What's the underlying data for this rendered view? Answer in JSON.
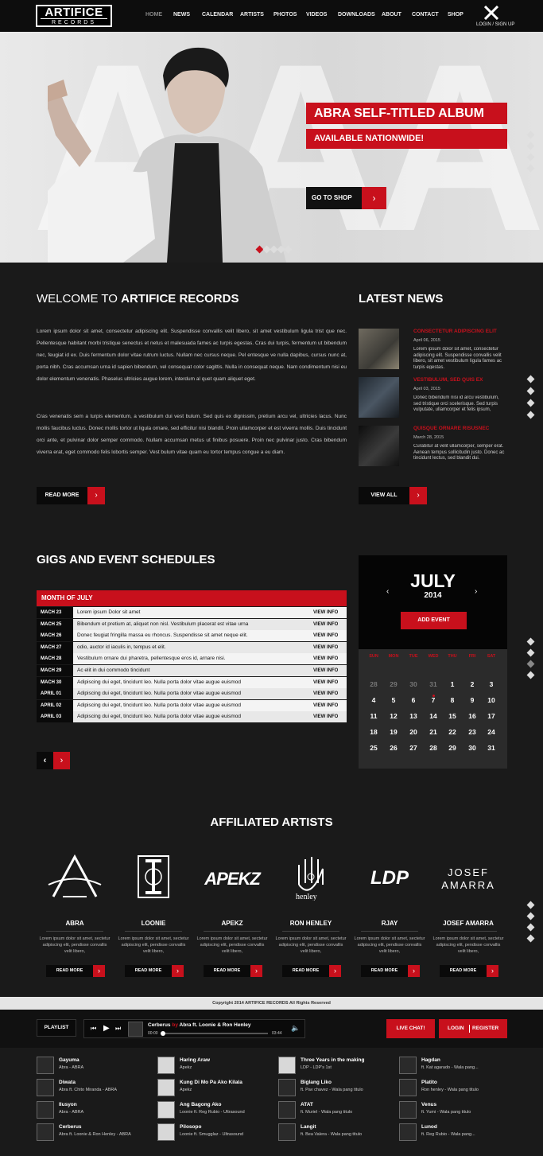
{
  "nav": {
    "logo_top": "ARTIFICE",
    "logo_bottom": "RECORDS",
    "items": [
      "HOME",
      "NEWS",
      "CALENDAR",
      "ARTISTS",
      "PHOTOS",
      "VIDEOS",
      "DOWNLOADS",
      "ABOUT",
      "CONTACT",
      "SHOP"
    ],
    "login_label": "LOGIN / SIGN UP"
  },
  "hero": {
    "headline": "ABRA SELF-TITLED ALBUM",
    "subline": "AVAILABLE NATIONWIDE!",
    "cta_label": "GO TO SHOP"
  },
  "welcome": {
    "title_light": "WELCOME TO ",
    "title_bold": "ARTIFICE RECORDS",
    "p1": "Lorem ipsum dolor sit amet, consectetur adipiscing elit. Suspendisse convallis velit libero, sit amet vestibulum ligula trist que nec. Pellentesque habitant morbi tristique senectus et netus et malesuada fames ac turpis egestas. Cras dui turpis, fermentum ut bibendum nec, feugiat id ex. Duis fermentum dolor vitae rutrum luctus. Nullam nec cursus neque. Pel entesque ve nulla dapibus, cursus nunc at, porta nibh. Cras accumsan urna id sapien bibendum, vel consequat color sagittis. Nulla in consequat neque. Nam condimentum nisi eu dolor elementum venenatis. Phaselus ultricies augue lorem, interdum al quet quam aliquet eget.",
    "p2": "Cras venenatis sem a turpis elementum, a vestibulum dui vest bulum. Sed quis ex dignissim, pretium arcu vel, ultricies lacus. Nunc mollis faucibus luctus. Donec mollis tortor ut ligula ornare, sed efficitur nisi blandit. Proin ullamcorper et est viverra mollis. Duis tincidunt orci ante, et pulvinar dolor semper commodo. Nullam accumsan metus ut finibus posuere. Proin nec pulvinar justo. Cras bibendum viverra erat, eget commodo felis lobortis semper. Vest bulum vitae quam eu tortor tempus congue a eu diam.",
    "read_more": "READ MORE"
  },
  "news": {
    "title": "LATEST NEWS",
    "items": [
      {
        "title": "CONSECTETUR ADIPISCING ELIT",
        "date": "April 06, 2015",
        "body": "Lorem ipsum dolor sit amet, consectetur adipiscing elit. Suspendisse convallis velit libero, sit amet vestibulum ligula fames ac turpis egestas."
      },
      {
        "title": "VESTIBULUM, SED QUIS EX",
        "date": "April 03, 2015",
        "body": "Donec bibendum nisi id arcu vestibulum, sed tristique orci scelerisque. Sed turpis vulputate, ullamcorper et felis ipsum,"
      },
      {
        "title": "QUISQUE ORNARE RISUSNEC",
        "date": "March 28, 2015",
        "body": "Curabitur at velit ullamcorper, semper erat. Aenean tempus sollicitudin justo. Donec ac tincidunt lectus, sed blandit dui."
      }
    ],
    "view_all": "VIEW ALL"
  },
  "gigs": {
    "title": "GIGS AND EVENT SCHEDULES",
    "month_label": "MONTH OF JULY",
    "view_label": "VIEW INFO",
    "rows": [
      {
        "date": "MACH 23",
        "text": "Lorem ipsum Dolor sit amet"
      },
      {
        "date": "MACH 25",
        "text": "Bibendum et pretium at, aliquet non nisl. Vestibulum placerat est vitae urna"
      },
      {
        "date": "MACH 26",
        "text": "Donec feugiat fringilla massa eu rhoncus. Suspendisse sit amet neque elit."
      },
      {
        "date": "MACH 27",
        "text": "odio, auctor id iaculis in, tempus et elit."
      },
      {
        "date": "MACH 28",
        "text": "Vestibulum ornare dui pharetra, pellentesque eros id, arnare nisi."
      },
      {
        "date": "MACH 29",
        "text": "Ac elit in dui commodo tincidunt"
      },
      {
        "date": "MACH 30",
        "text": "Adipiscing dui eget, tincidunt leo. Nulla porta dolor vitae augue euismod"
      },
      {
        "date": "APRIL 01",
        "text": "Adipiscing dui eget, tincidunt leo. Nulla porta dolor vitae augue euismod"
      },
      {
        "date": "APRIL 02",
        "text": "Adipiscing dui eget, tincidunt leo. Nulla porta dolor vitae augue euismod"
      },
      {
        "date": "APRIL 03",
        "text": "Adipiscing dui eget, tincidunt leo. Nulla porta dolor vitae augue euismod"
      }
    ]
  },
  "calendar": {
    "month": "JULY",
    "year": "2014",
    "add_event": "ADD EVENT",
    "weekdays": [
      "SUN",
      "MON",
      "TUE",
      "WED",
      "THU",
      "FRI",
      "SAT"
    ],
    "weeks": [
      [
        "28",
        "29",
        "30",
        "31",
        "1",
        "2",
        "3"
      ],
      [
        "4",
        "5",
        "6",
        "7",
        "8",
        "9",
        "10"
      ],
      [
        "11",
        "12",
        "13",
        "14",
        "15",
        "16",
        "17"
      ],
      [
        "18",
        "19",
        "20",
        "21",
        "22",
        "23",
        "24"
      ],
      [
        "25",
        "26",
        "27",
        "28",
        "29",
        "30",
        "31"
      ]
    ]
  },
  "artists": {
    "title": "AFFILIATED ARTISTS",
    "desc": "Lorem ipsum dolor sit amet, sectetur adipiscing elit, pendisse convallis velit libero,",
    "read_more": "READ MORE",
    "items": [
      {
        "name": "ABRA",
        "logo": "A"
      },
      {
        "name": "LOONIE",
        "logo": "L"
      },
      {
        "name": "APEKZ",
        "logo": "APEKZ"
      },
      {
        "name": "RON HENLEY",
        "logo": "henley"
      },
      {
        "name": "RJAY",
        "logo": "LDP"
      },
      {
        "name": "JOSEF AMARRA",
        "logo": "JOSEF AMARRA"
      }
    ]
  },
  "footer": {
    "copyright": "Copyright 2014 ARTIFICE RECORDS All Rights Reserved"
  },
  "player": {
    "playlist_label": "PLAYLIST",
    "track": "Cerberus",
    "by": "by",
    "artist": "Abra ft. Loonie & Ron Henley",
    "time_start": "00:00",
    "time_end": "03:44",
    "live_chat": "LIVE CHAT!",
    "login": "LOGIN",
    "register": "REGISTER"
  },
  "playlist": [
    [
      {
        "title": "Gayuma",
        "sub": "Abra - ABRA"
      },
      {
        "title": "Diwata",
        "sub": "Abra ft. Chito Miranda - ABRA"
      },
      {
        "title": "Ilusyon",
        "sub": "Abra - ABRA"
      },
      {
        "title": "Cerberus",
        "sub": "Abra ft. Loonie & Ron Henley - ABRA"
      }
    ],
    [
      {
        "title": "Haring Araw",
        "sub": "Apekz"
      },
      {
        "title": "Kung Di Mo Pa Ako Kilala",
        "sub": "Apekz"
      },
      {
        "title": "Ang Bagong Ako",
        "sub": "Loonie ft. Reg Rubio - Ultrasound"
      },
      {
        "title": "Pilosopo",
        "sub": "Loonie ft. Smugglaz - Ultrasound"
      }
    ],
    [
      {
        "title": "Three Years in the making",
        "sub": "LDP - LDP's 1st"
      },
      {
        "title": "Biglang Liko",
        "sub": "ft. Pav chavez - Wala pang titulo"
      },
      {
        "title": "ATAT",
        "sub": "ft. Muriel - Wala pang titulo"
      },
      {
        "title": "Langit",
        "sub": "ft. Bea Valera - Wala pang titulo"
      }
    ],
    [
      {
        "title": "Hagdan",
        "sub": "ft. Kat agarado - Wala pang..."
      },
      {
        "title": "Platito",
        "sub": "Ron henley - Wala pang titulo"
      },
      {
        "title": "Venus",
        "sub": "ft. Yumi - Wala pang titulo"
      },
      {
        "title": "Lunod",
        "sub": "ft. Reg Rubio - Wala pang..."
      }
    ]
  ]
}
